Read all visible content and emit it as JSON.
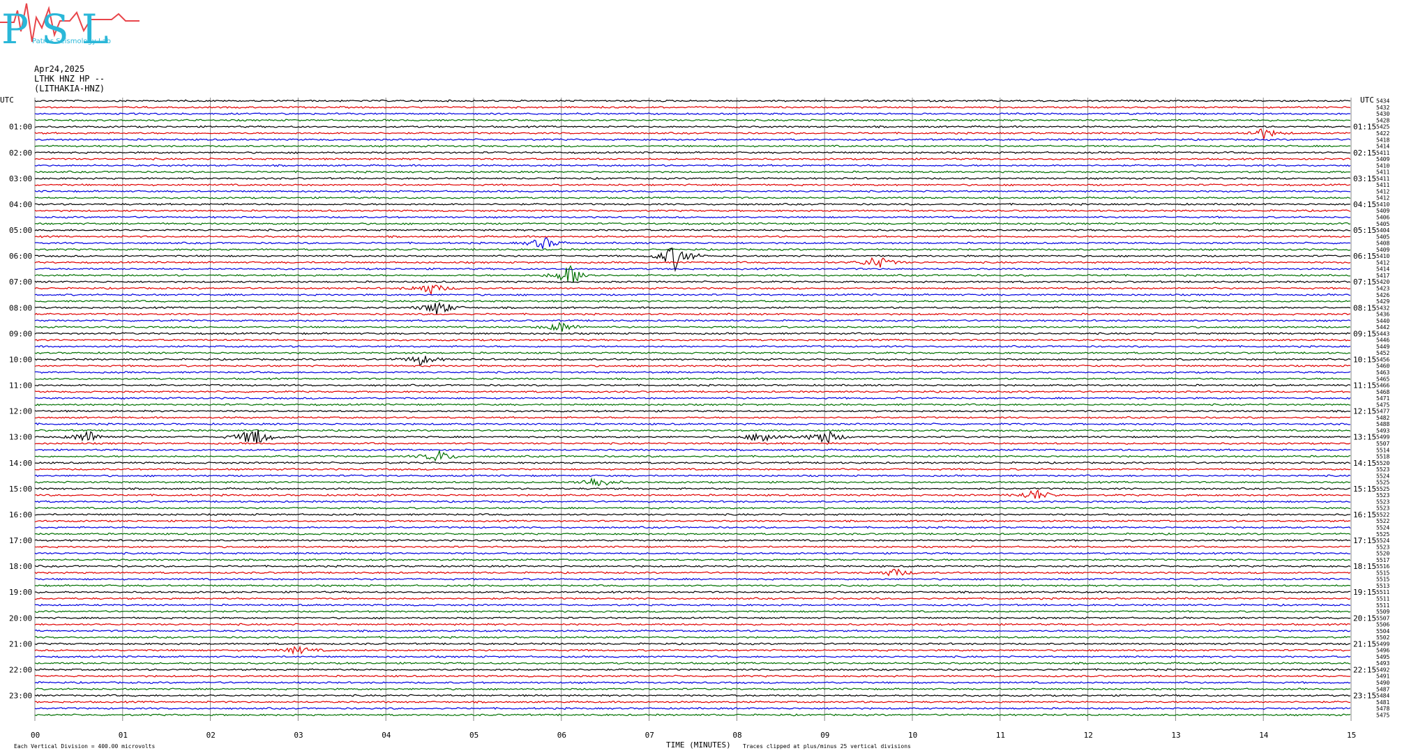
{
  "logo": {
    "letters": "PSL",
    "subtitle": "Patras Seismology Lab",
    "colors": {
      "letters": "#2ab7d8",
      "trace": "#e8454a"
    }
  },
  "header": {
    "date": "Apr24,2025",
    "station": "LTHK HNZ HP --",
    "location": "(LITHAKIA-HNZ)"
  },
  "footer": {
    "left_note": "Each Vertical Division =  400.00 microvolts",
    "x_axis_label": "TIME (MINUTES)",
    "clip_note": "Traces clipped at plus/minus 25 vertical divisions"
  },
  "colors": {
    "trace_cycle": [
      "#000000",
      "#e00000",
      "#0000e0",
      "#007000"
    ],
    "grid": "#888888"
  },
  "chart_data": {
    "type": "line",
    "description_of_axes": "helicorder: each row is a 15-minute trace",
    "x_ticks": [
      "00",
      "01",
      "02",
      "03",
      "04",
      "05",
      "06",
      "07",
      "08",
      "09",
      "10",
      "11",
      "12",
      "13",
      "14",
      "15"
    ],
    "xlim": [
      0,
      15
    ],
    "left_label_top": "UTC",
    "right_label_top": "UTC",
    "left_hour_labels": [
      "01:00",
      "02:00",
      "03:00",
      "04:00",
      "05:00",
      "06:00",
      "07:00",
      "08:00",
      "09:00",
      "10:00",
      "11:00",
      "12:00",
      "13:00",
      "14:00",
      "15:00",
      "16:00",
      "17:00",
      "18:00",
      "19:00",
      "20:00",
      "21:00",
      "22:00",
      "23:00"
    ],
    "right_hour_labels": [
      "01:15",
      "02:15",
      "03:15",
      "04:15",
      "05:15",
      "06:15",
      "07:15",
      "08:15",
      "09:15",
      "10:15",
      "11:15",
      "12:15",
      "13:15",
      "14:15",
      "15:15",
      "16:15",
      "17:15",
      "18:15",
      "19:15",
      "20:15",
      "21:15",
      "22:15",
      "23:15"
    ],
    "trace_counts": [
      "5434",
      "5432",
      "5430",
      "5428",
      "5425",
      "5422",
      "5418",
      "5414",
      "5411",
      "5409",
      "5410",
      "5411",
      "5411",
      "5411",
      "5412",
      "5412",
      "5410",
      "5409",
      "5406",
      "5405",
      "5404",
      "5405",
      "5408",
      "5409",
      "5410",
      "5412",
      "5414",
      "5417",
      "5420",
      "5423",
      "5426",
      "5429",
      "5432",
      "5436",
      "5440",
      "5442",
      "5443",
      "5446",
      "5449",
      "5452",
      "5456",
      "5460",
      "5463",
      "5465",
      "5466",
      "5468",
      "5471",
      "5475",
      "5477",
      "5482",
      "5488",
      "5493",
      "5499",
      "5507",
      "5514",
      "5518",
      "5520",
      "5523",
      "5524",
      "5525",
      "5525",
      "5523",
      "5523",
      "5523",
      "5522",
      "5522",
      "5524",
      "5525",
      "5524",
      "5523",
      "5520",
      "5517",
      "5516",
      "5515",
      "5515",
      "5513",
      "5511",
      "5511",
      "5511",
      "5509",
      "5507",
      "5506",
      "5504",
      "5502",
      "5499",
      "5496",
      "5495",
      "5493",
      "5492",
      "5491",
      "5490",
      "5487",
      "5484",
      "5481",
      "5478",
      "5475"
    ],
    "events": [
      {
        "row": 5,
        "minute": 14.0,
        "amp": 8
      },
      {
        "row": 22,
        "minute": 5.8,
        "amp": 9
      },
      {
        "row": 24,
        "minute": 7.3,
        "amp": 20
      },
      {
        "row": 25,
        "minute": 9.6,
        "amp": 10
      },
      {
        "row": 27,
        "minute": 6.1,
        "amp": 16
      },
      {
        "row": 29,
        "minute": 4.5,
        "amp": 9
      },
      {
        "row": 32,
        "minute": 4.6,
        "amp": 12
      },
      {
        "row": 35,
        "minute": 6.0,
        "amp": 8
      },
      {
        "row": 40,
        "minute": 4.4,
        "amp": 8
      },
      {
        "row": 52,
        "minute": 2.5,
        "amp": 16
      },
      {
        "row": 52,
        "minute": 8.3,
        "amp": 10
      },
      {
        "row": 52,
        "minute": 9.0,
        "amp": 12
      },
      {
        "row": 52,
        "minute": 0.6,
        "amp": 10
      },
      {
        "row": 55,
        "minute": 4.6,
        "amp": 9
      },
      {
        "row": 59,
        "minute": 6.4,
        "amp": 9
      },
      {
        "row": 61,
        "minute": 11.4,
        "amp": 9
      },
      {
        "row": 73,
        "minute": 9.8,
        "amp": 6
      },
      {
        "row": 85,
        "minute": 3.0,
        "amp": 6
      }
    ]
  }
}
